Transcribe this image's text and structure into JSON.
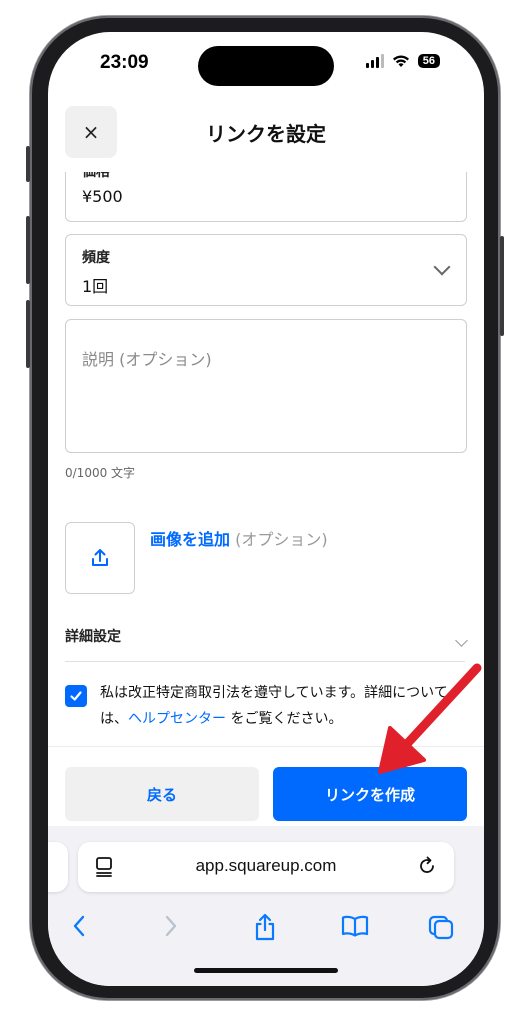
{
  "status_bar": {
    "time": "23:09",
    "battery": "56"
  },
  "header": {
    "close_symbol": "×",
    "title": "リンクを設定"
  },
  "form": {
    "price": {
      "label": "価格",
      "value": "¥500"
    },
    "frequency": {
      "label": "頻度",
      "value": "1回"
    },
    "description": {
      "placeholder": "説明 (オプション)",
      "counter": "0/1000 文字"
    },
    "image": {
      "add_label": "画像を追加",
      "optional": " (オプション)"
    },
    "advanced": {
      "label": "詳細設定"
    },
    "legal": {
      "text_before": "私は改正特定商取引法を遵守しています。詳細については、",
      "link": "ヘルプセンター",
      "text_after": " をご覧ください。"
    }
  },
  "footer": {
    "back_label": "戻る",
    "create_label": "リンクを作成"
  },
  "browser": {
    "url": "app.squareup.com"
  },
  "colors": {
    "accent": "#006aff",
    "annotation_arrow": "#e0202a"
  }
}
